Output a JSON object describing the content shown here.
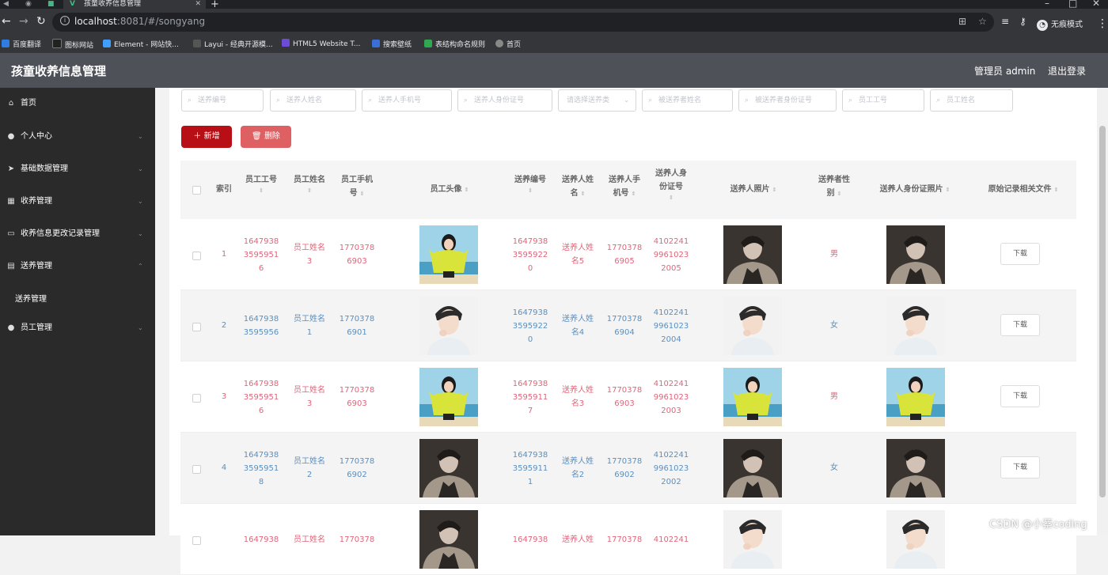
{
  "browser": {
    "tab_title": "孩童收养信息管理",
    "url_host": "localhost",
    "url_rest": ":8081/#/songyang",
    "incognito_label": "无痕模式",
    "bookmarks": [
      "百度翻译",
      "图标网站",
      "Element - 网站快...",
      "Layui - 经典开源模...",
      "HTML5 Website T...",
      "搜索壁纸",
      "表结构命名规则",
      "首页"
    ]
  },
  "header": {
    "title": "孩童收养信息管理",
    "admin_label": "管理员 admin",
    "logout_label": "退出登录"
  },
  "sidebar": {
    "items": [
      {
        "label": "首页",
        "icon": "home-icon"
      },
      {
        "label": "个人中心",
        "icon": "user-icon"
      },
      {
        "label": "基础数据管理",
        "icon": "send-icon"
      },
      {
        "label": "收养管理",
        "icon": "grid-icon"
      },
      {
        "label": "收养信息更改记录管理",
        "icon": "chat-icon"
      },
      {
        "label": "送养管理",
        "icon": "calendar-icon"
      },
      {
        "label": "员工管理",
        "icon": "user-icon"
      }
    ],
    "subitem": "送养管理"
  },
  "filters": {
    "placeholders": [
      "送养编号",
      "送养人姓名",
      "送养人手机号",
      "送养人身份证号",
      "请选择送养类",
      "被送养者姓名",
      "被送养者身份证号",
      "员工工号",
      "员工姓名"
    ]
  },
  "toolbar": {
    "add_label": "新增",
    "delete_label": "删除"
  },
  "table": {
    "headers": {
      "index": "索引",
      "emp_no": [
        "员工工号"
      ],
      "emp_name": [
        "员工姓名"
      ],
      "emp_phone": [
        "员工手机",
        "号"
      ],
      "emp_avatar": "员工头像",
      "adopt_no": "送养编号",
      "giver_name": [
        "送养人姓",
        "名"
      ],
      "giver_phone": [
        "送养人手",
        "机号"
      ],
      "giver_id": [
        "送养人身",
        "份证号"
      ],
      "giver_photo": "送养人照片",
      "gender": [
        "送养者性",
        "别"
      ],
      "giver_id_photo": "送养人身份证照片",
      "files": "原始记录相关文件"
    },
    "rows": [
      {
        "index": "1",
        "emp_no": [
          "1647938",
          "3595951",
          "6"
        ],
        "emp_name": [
          "员工姓名",
          "3"
        ],
        "emp_phone": [
          "1770378",
          "6903"
        ],
        "adopt_no": [
          "1647938",
          "3595922",
          "0"
        ],
        "giver_name": [
          "送养人姓",
          "名5"
        ],
        "giver_phone": [
          "1770378",
          "6905"
        ],
        "giver_id": [
          "4102241",
          "9961023",
          "2005"
        ],
        "gender": "男",
        "download": "下载",
        "color": "#e0657a",
        "avatar": "girl",
        "photo": "man-dark",
        "id_photo": "man-dark"
      },
      {
        "index": "2",
        "emp_no": [
          "1647938",
          "3595956"
        ],
        "emp_name": [
          "员工姓名",
          "1"
        ],
        "emp_phone": [
          "1770378",
          "6901"
        ],
        "adopt_no": [
          "1647938",
          "3595922",
          "0"
        ],
        "giver_name": [
          "送养人姓",
          "名4"
        ],
        "giver_phone": [
          "1770378",
          "6904"
        ],
        "giver_id": [
          "4102241",
          "9961023",
          "2004"
        ],
        "gender": "女",
        "download": "下载",
        "color": "#5b8fbf",
        "avatar": "boy",
        "photo": "boy",
        "id_photo": "boy"
      },
      {
        "index": "3",
        "emp_no": [
          "1647938",
          "3595951",
          "6"
        ],
        "emp_name": [
          "员工姓名",
          "3"
        ],
        "emp_phone": [
          "1770378",
          "6903"
        ],
        "adopt_no": [
          "1647938",
          "3595911",
          "7"
        ],
        "giver_name": [
          "送养人姓",
          "名3"
        ],
        "giver_phone": [
          "1770378",
          "6903"
        ],
        "giver_id": [
          "4102241",
          "9961023",
          "2003"
        ],
        "gender": "男",
        "download": "下载",
        "color": "#e0657a",
        "avatar": "girl",
        "photo": "girl",
        "id_photo": "girl"
      },
      {
        "index": "4",
        "emp_no": [
          "1647938",
          "3595951",
          "8"
        ],
        "emp_name": [
          "员工姓名",
          "2"
        ],
        "emp_phone": [
          "1770378",
          "6902"
        ],
        "adopt_no": [
          "1647938",
          "3595911",
          "1"
        ],
        "giver_name": [
          "送养人姓",
          "名2"
        ],
        "giver_phone": [
          "1770378",
          "6902"
        ],
        "giver_id": [
          "4102241",
          "9961023",
          "2002"
        ],
        "gender": "女",
        "download": "下载",
        "color": "#5b8fbf",
        "avatar": "man-dark",
        "photo": "man-dark",
        "id_photo": "man-dark"
      },
      {
        "index": "",
        "emp_no": [
          "1647938"
        ],
        "emp_name": [
          "员工姓名"
        ],
        "emp_phone": [
          "1770378"
        ],
        "adopt_no": [
          "1647938"
        ],
        "giver_name": [
          "送养人姓"
        ],
        "giver_phone": [
          "1770378"
        ],
        "giver_id": [
          "4102241"
        ],
        "gender": "",
        "download": "",
        "color": "#e0657a",
        "avatar": "man-dark",
        "photo": "boy",
        "id_photo": "boy"
      }
    ]
  },
  "watermark": "CSDN @小蔡coding",
  "colors": {
    "accent": "#b80f16",
    "danger": "#de6063",
    "sidebar": "#2a2a2a",
    "header": "#4e5157",
    "row_red": "#e0657a",
    "row_blue": "#5b8fbf"
  }
}
